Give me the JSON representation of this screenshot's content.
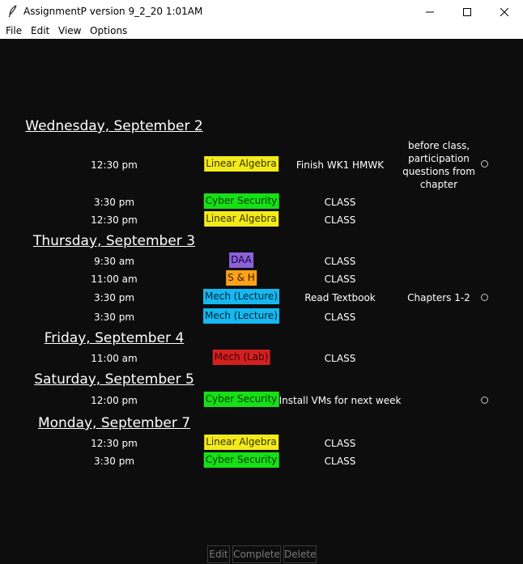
{
  "window": {
    "title": "AssignmentP version 9_2_20 1:01AM"
  },
  "menu": [
    "File",
    "Edit",
    "View",
    "Options"
  ],
  "colors": {
    "linear_algebra": "#f2eb1a",
    "cyber_security": "#16e016",
    "daa": "#8c62d8",
    "s_and_h": "#ffa11a",
    "mech_lecture": "#16b8ef",
    "mech_lab": "#d32020"
  },
  "days": [
    {
      "label": "Wednesday, September 2",
      "items": [
        {
          "time": "12:30 pm",
          "course": "Linear Algebra",
          "task": "Finish WK1 HMWK",
          "note": "before class, participation questions from chapter",
          "has_toggle": true
        },
        {
          "time": "3:30 pm",
          "course": "Cyber Security",
          "task": "CLASS",
          "note": "",
          "has_toggle": false
        },
        {
          "time": "12:30 pm",
          "course": "Linear Algebra",
          "task": "CLASS",
          "note": "",
          "has_toggle": false
        }
      ]
    },
    {
      "label": "Thursday, September 3",
      "items": [
        {
          "time": "9:30 am",
          "course": "DAA",
          "task": "CLASS",
          "note": "",
          "has_toggle": false
        },
        {
          "time": "11:00 am",
          "course": "S & H",
          "task": "CLASS",
          "note": "",
          "has_toggle": false
        },
        {
          "time": "3:30 pm",
          "course": "Mech (Lecture)",
          "task": "Read Textbook",
          "note": "Chapters 1-2",
          "has_toggle": true
        },
        {
          "time": "3:30 pm",
          "course": "Mech (Lecture)",
          "task": "CLASS",
          "note": "",
          "has_toggle": false
        }
      ]
    },
    {
      "label": "Friday, September 4",
      "items": [
        {
          "time": "11:00 am",
          "course": "Mech (Lab)",
          "task": "CLASS",
          "note": "",
          "has_toggle": false
        }
      ]
    },
    {
      "label": "Saturday, September 5",
      "items": [
        {
          "time": "12:00 pm",
          "course": "Cyber Security",
          "task": "Install VMs for next week",
          "note": "",
          "has_toggle": true
        }
      ]
    },
    {
      "label": "Monday, September 7",
      "items": [
        {
          "time": "12:30 pm",
          "course": "Linear Algebra",
          "task": "CLASS",
          "note": "",
          "has_toggle": false
        },
        {
          "time": "3:30 pm",
          "course": "Cyber Security",
          "task": "CLASS",
          "note": "",
          "has_toggle": false
        }
      ]
    }
  ],
  "actions": [
    "Edit",
    "Complete",
    "Delete"
  ]
}
